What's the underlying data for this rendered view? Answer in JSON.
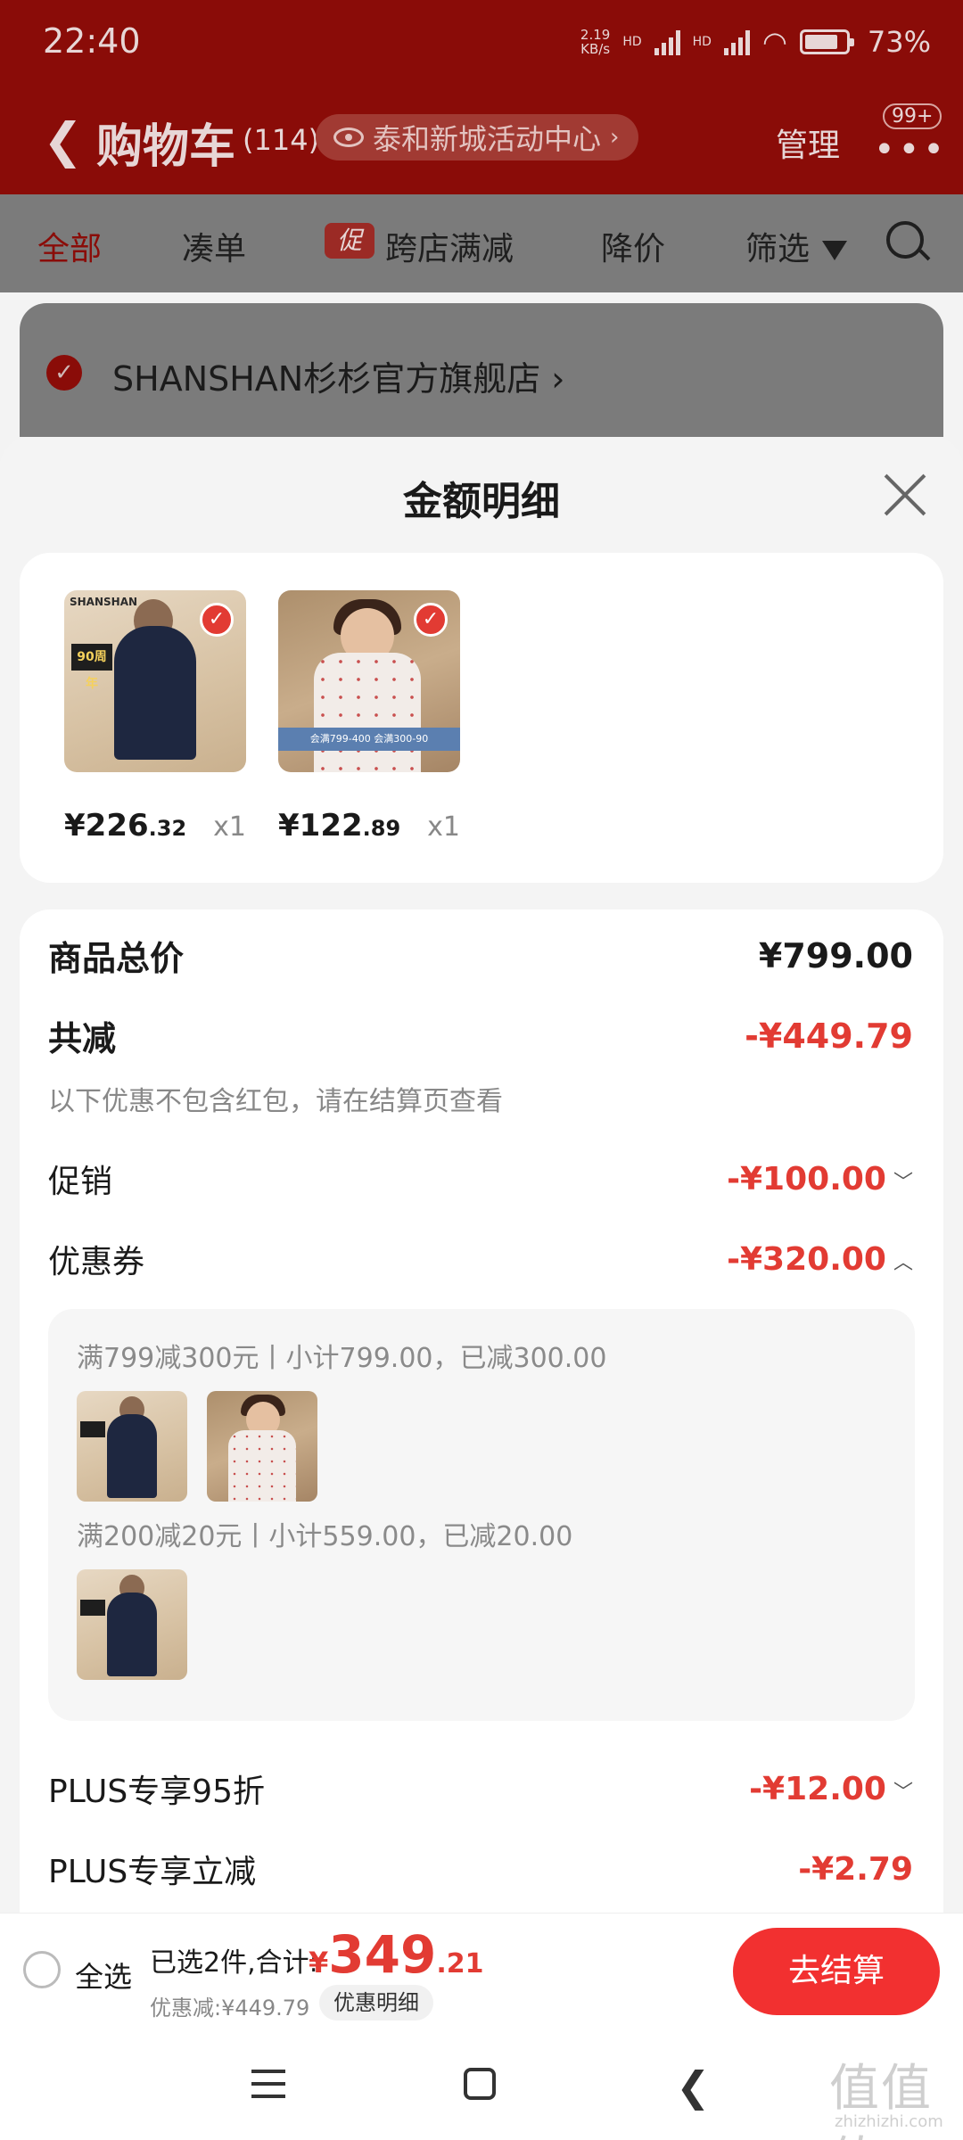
{
  "status_bar": {
    "time": "22:40",
    "net_speed_top": "2.19",
    "net_speed_bottom": "KB/s",
    "hd1": "HD",
    "hd2": "HD",
    "battery": "73%"
  },
  "header": {
    "title": "购物车",
    "count": "(114)",
    "location": "泰和新城活动中心",
    "manage": "管理",
    "badge": "99+"
  },
  "tabs": {
    "all": "全部",
    "bundle": "凑单",
    "promo_badge": "促",
    "cross_store": "跨店满减",
    "price_drop": "降价",
    "filter": "筛选"
  },
  "store": {
    "name": "SHANSHAN杉杉官方旗舰店 ›"
  },
  "sheet": {
    "title": "金额明细",
    "products": [
      {
        "price_int": "¥226",
        "price_dec": ".32",
        "qty": "x1",
        "brand": "SHANSHAN",
        "tag": "90周年"
      },
      {
        "price_int": "¥122",
        "price_dec": ".89",
        "qty": "x1",
        "banner": "会满799-400 会满300-90"
      }
    ],
    "total_label": "商品总价",
    "total_value": "¥799.00",
    "reduce_label": "共减",
    "reduce_value": "-¥449.79",
    "note": "以下优惠不包含红包，请在结算页查看",
    "promo_label": "促销",
    "promo_value": "-¥100.00",
    "coupon_label": "优惠券",
    "coupon_value": "-¥320.00",
    "coupon_line1": "满799减300元丨小计799.00，已减300.00",
    "coupon_line2": "满200减20元丨小计559.00，已减20.00",
    "plus95_label": "PLUS专享95折",
    "plus95_value": "-¥12.00",
    "plusminus_label": "PLUS专享立减",
    "plusminus_value": "-¥2.79"
  },
  "action_bar": {
    "select_all": "全选",
    "summary": "已选2件,合计:",
    "currency": "¥",
    "total_int": "349",
    "total_dec": ".21",
    "discount": "优惠减:¥449.79",
    "detail_chip": "优惠明细",
    "checkout": "去结算"
  },
  "watermark": {
    "main": "值值值",
    "sub": "zhizhizhi.com"
  }
}
